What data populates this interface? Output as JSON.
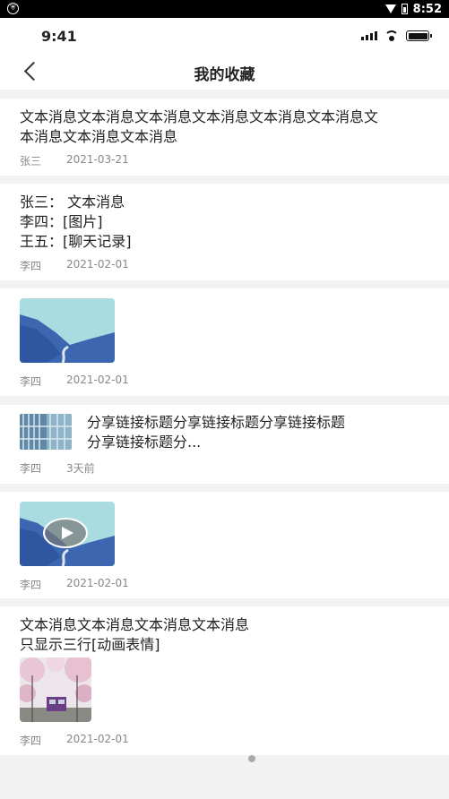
{
  "system_status": {
    "time": "8:52"
  },
  "ios_status": {
    "time": "9:41"
  },
  "nav": {
    "title": "我的收藏"
  },
  "items": [
    {
      "line1": "文本消息文本消息文本消息文本消息文本消息文本消息文",
      "line2": "本消息文本消息文本消息",
      "author": "张三",
      "date": "2021-03-21"
    },
    {
      "line1": "张三： 文本消息",
      "line2": "李四：[图片]",
      "line3": "王五：[聊天记录]",
      "author": "李四",
      "date": "2021-02-01"
    },
    {
      "author": "李四",
      "date": "2021-02-01"
    },
    {
      "line1": "分享链接标题分享链接标题分享链接标题",
      "line2": "分享链接标题分...",
      "author": "李四",
      "date": "3天前"
    },
    {
      "author": "李四",
      "date": "2021-02-01"
    },
    {
      "line1": "文本消息文本消息文本消息文本消息",
      "line2": "只显示三行[动画表情]",
      "author": "李四",
      "date": "2021-02-01"
    }
  ]
}
